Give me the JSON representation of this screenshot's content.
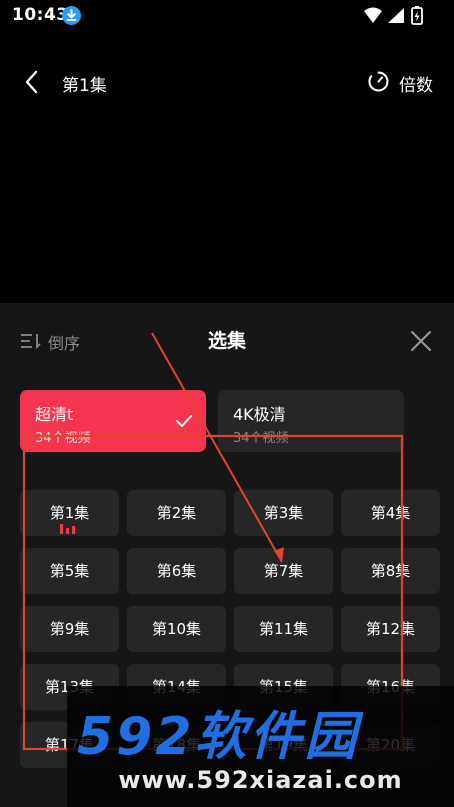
{
  "status_bar": {
    "time": "10:43"
  },
  "header": {
    "episode_title": "第1集",
    "speed_label": "倍数"
  },
  "sheet": {
    "sort_label": "倒序",
    "title": "选集",
    "qualities": [
      {
        "name": "超清t",
        "count": "34个视频",
        "selected": true
      },
      {
        "name": "4K极清",
        "count": "34个视频",
        "selected": false
      }
    ],
    "episodes": [
      "第1集",
      "第2集",
      "第3集",
      "第4集",
      "第5集",
      "第6集",
      "第7集",
      "第8集",
      "第9集",
      "第10集",
      "第11集",
      "第12集",
      "第13集",
      "第14集",
      "第15集",
      "第16集",
      "第17集",
      "第18集",
      "第19集",
      "第20集"
    ],
    "playing_episode": 1
  },
  "colors": {
    "accent": "#f5344f",
    "annotation": "#e0452d",
    "watermark_blue": "#1f6fe3"
  },
  "watermark": {
    "logo": "592软件园",
    "url": "www.592xiazai.com"
  }
}
